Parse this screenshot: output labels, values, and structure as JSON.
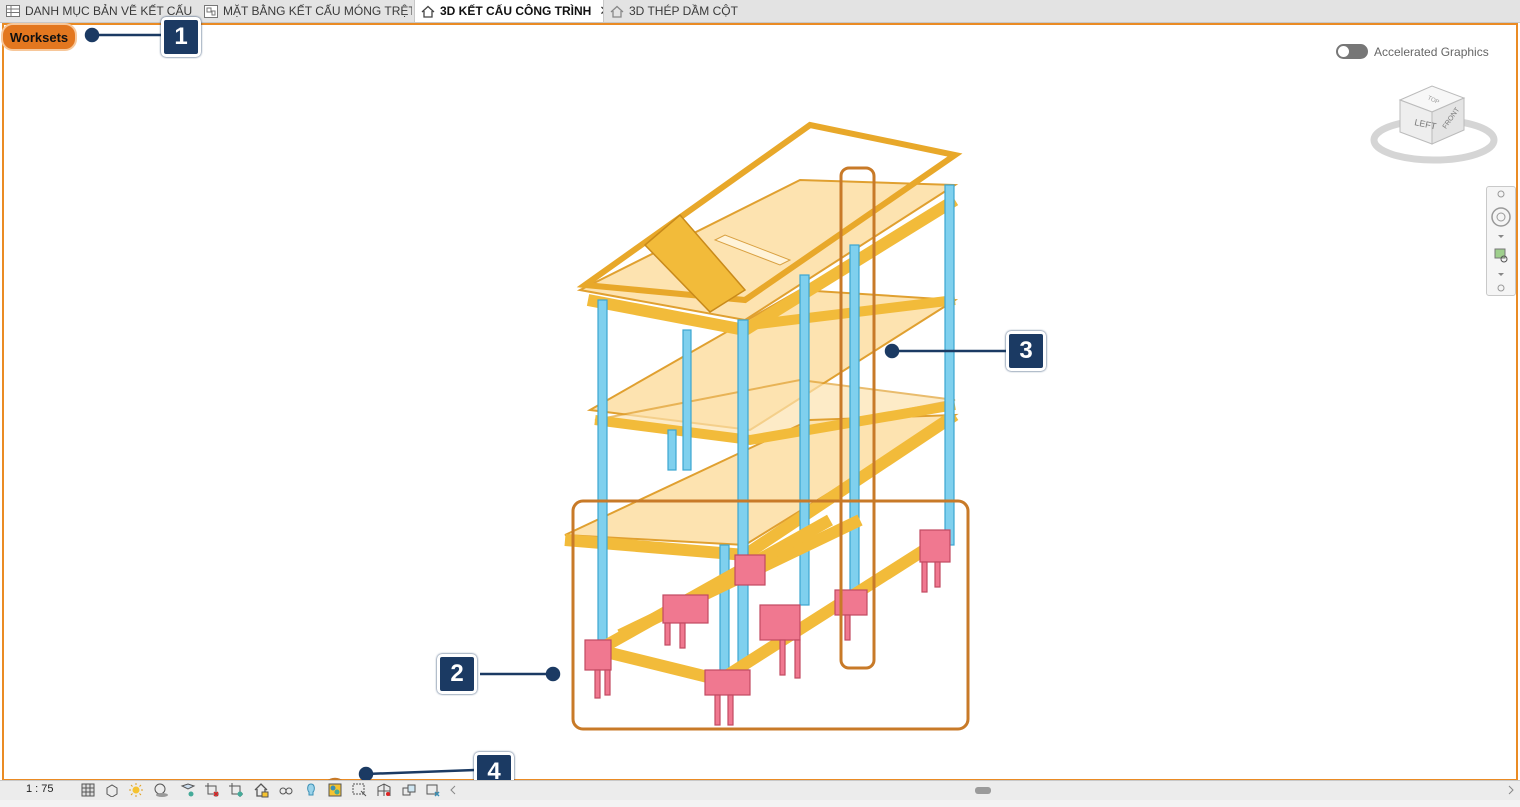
{
  "tabs": [
    {
      "label": "DANH MỤC BẢN VẼ KẾT CẤU",
      "icon": "sheet-list-icon",
      "active": false
    },
    {
      "label": "MẶT BẰNG KẾT CẤU MÓNG TRỆT",
      "icon": "plan-view-icon",
      "active": false
    },
    {
      "label": "3D KẾT CẤU CÔNG TRÌNH",
      "icon": "house-3d-icon",
      "active": true,
      "close": "✕"
    },
    {
      "label": "3D THÉP DẦM CỘT",
      "icon": "house-3d-icon",
      "active": false
    }
  ],
  "worksets_label": "Worksets",
  "accelerated_graphics_label": "Accelerated Graphics",
  "viewcube": {
    "left_label": "LEFT",
    "front_label": "FRONT",
    "top_label": "TOP"
  },
  "callouts": [
    "1",
    "2",
    "3",
    "4"
  ],
  "status": {
    "scale": "1 : 75"
  },
  "colors": {
    "accent_orange": "#ea8b24",
    "callout_navy": "#1b3a63",
    "beam_yellow": "#f2bb3a",
    "slab_cream": "#fde3b0",
    "column_blue": "#7fd0ee",
    "footing_pink": "#f07890",
    "highlight_brown": "#c87a28"
  }
}
